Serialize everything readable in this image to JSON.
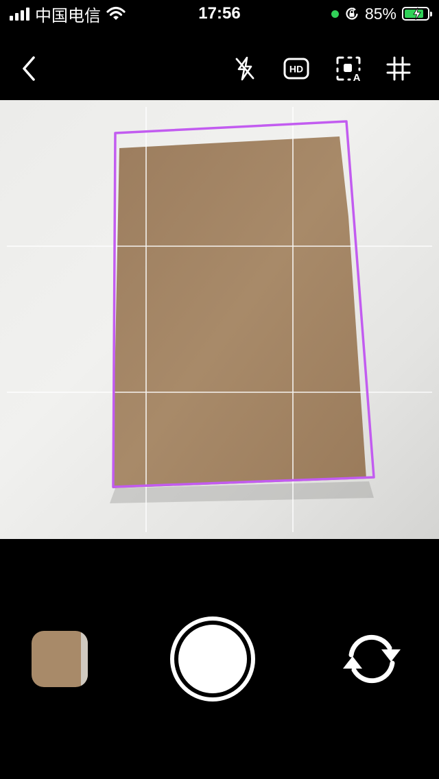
{
  "status_bar": {
    "carrier": "中国电信",
    "time": "17:56",
    "battery": "85%",
    "battery_level": 0.85,
    "signal_icon": "signal-bars-icon",
    "wifi_icon": "wifi-icon",
    "lock_icon": "orientation-lock-icon",
    "mic_indicator_color": "#31d158"
  },
  "toolbar": {
    "back_icon": "back-chevron-icon",
    "flash_icon": "flash-off-icon",
    "hd_label": "HD",
    "auto_detect_label": "A",
    "grid_icon": "grid-icon"
  },
  "viewfinder": {
    "detection_border_color": "#c25cf0",
    "paper_color": "#a88a69"
  },
  "bottom": {
    "thumbnail_icon": "last-photo-thumbnail",
    "shutter_icon": "shutter-button",
    "switch_camera_icon": "switch-camera-icon"
  }
}
